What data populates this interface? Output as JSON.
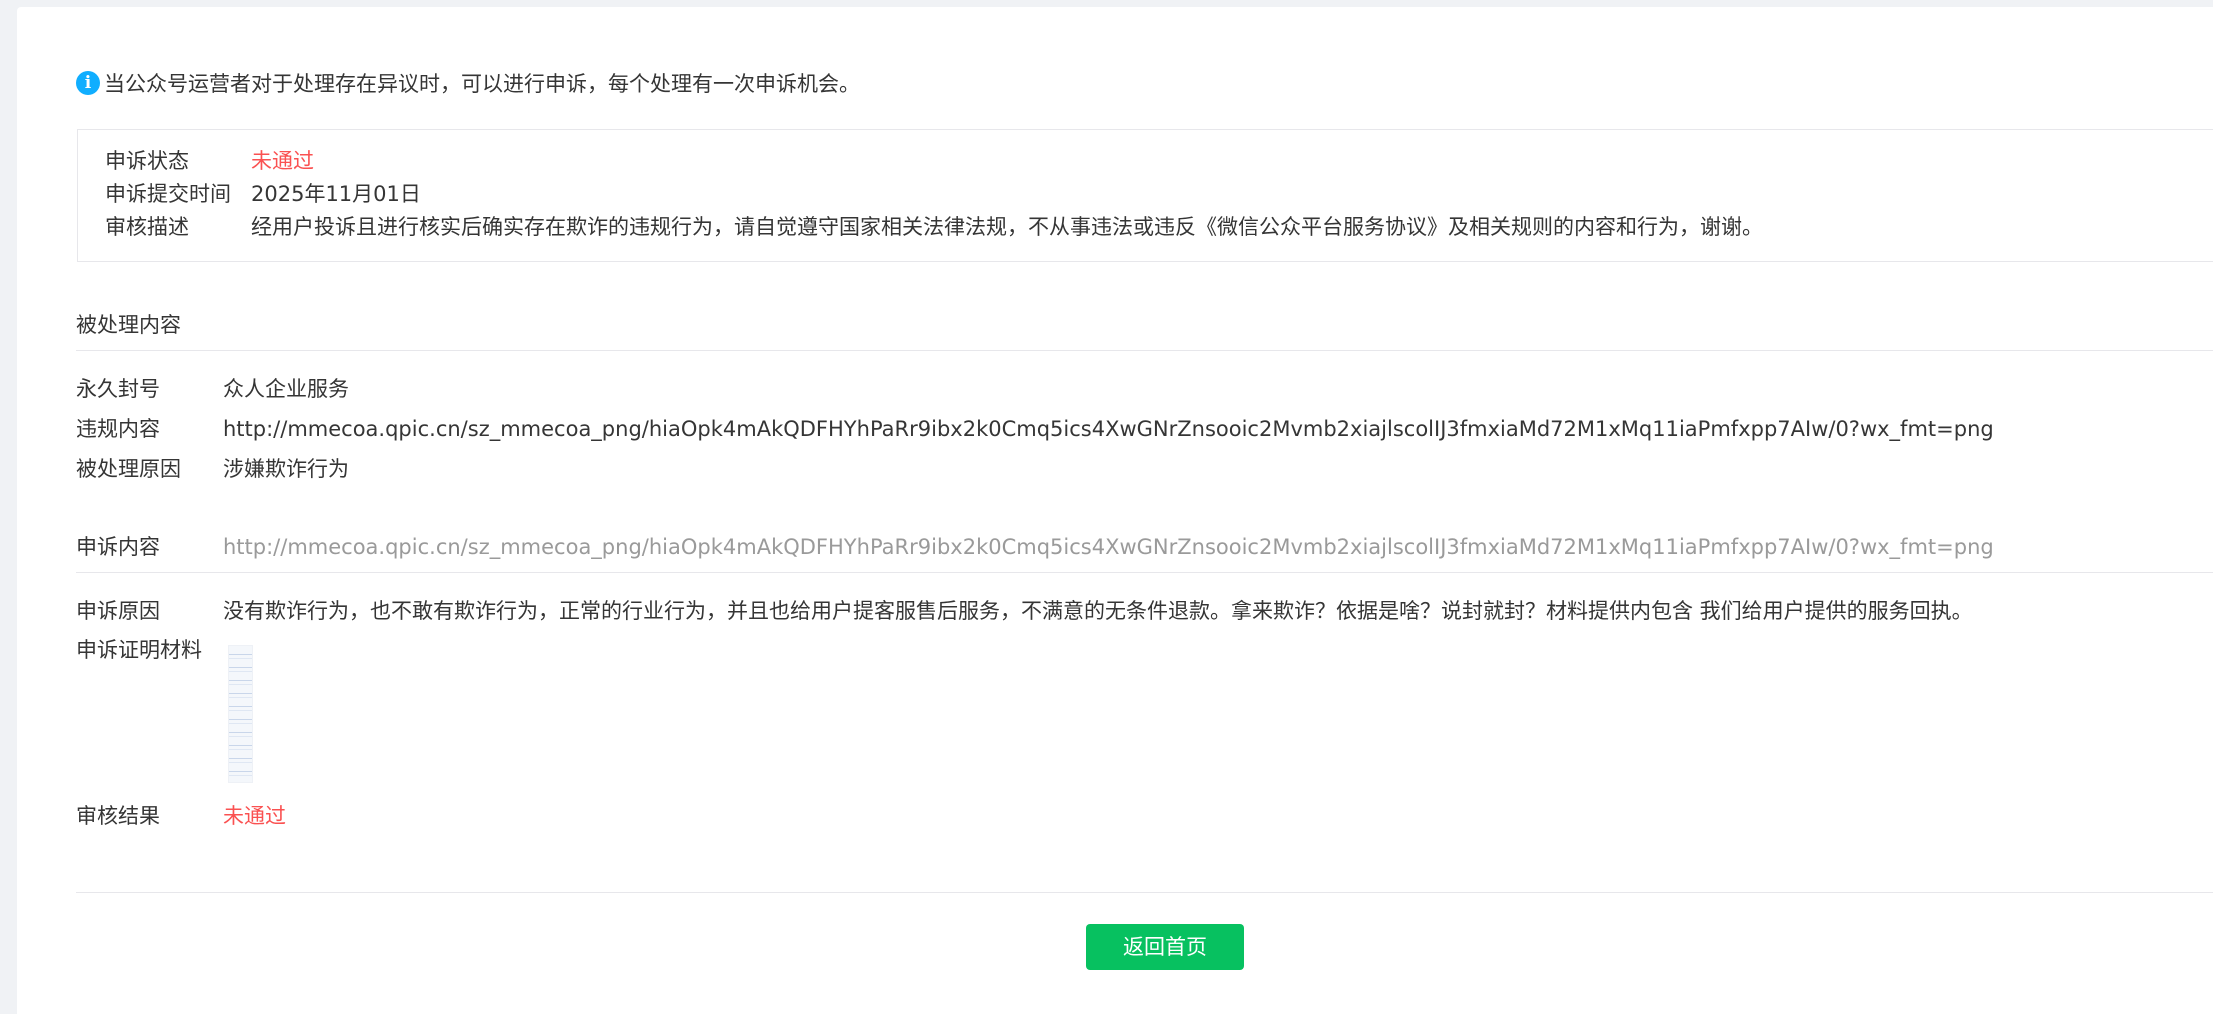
{
  "notice": {
    "icon": "info-icon",
    "icon_color": "#10aeff",
    "text": "当公众号运营者对于处理存在异议时，可以进行申诉，每个处理有一次申诉机会。"
  },
  "appeal_status": {
    "status_label": "申诉状态",
    "status_value": "未通过",
    "submit_time_label": "申诉提交时间",
    "submit_time_value": "2025年11月01日",
    "review_desc_label": "审核描述",
    "review_desc_value": "经用户投诉且进行核实后确实存在欺诈的违规行为，请自觉遵守国家相关法律法规，不从事违法或违反《微信公众平台服务协议》及相关规则的内容和行为，谢谢。"
  },
  "processed": {
    "section_title": "被处理内容",
    "ban_label": "永久封号",
    "ban_value": "众人企业服务",
    "violation_label": "违规内容",
    "violation_value": "http://mmecoa.qpic.cn/sz_mmecoa_png/hiaOpk4mAkQDFHYhPaRr9ibx2k0Cmq5ics4XwGNrZnsooic2Mvmb2xiajlscolIJ3fmxiaMd72M1xMq11iaPmfxpp7AIw/0?wx_fmt=png",
    "reason_label": "被处理原因",
    "reason_value": "涉嫌欺诈行为"
  },
  "appeal": {
    "content_label": "申诉内容",
    "content_value": "http://mmecoa.qpic.cn/sz_mmecoa_png/hiaOpk4mAkQDFHYhPaRr9ibx2k0Cmq5ics4XwGNrZnsooic2Mvmb2xiajlscolIJ3fmxiaMd72M1xMq11iaPmfxpp7AIw/0?wx_fmt=png",
    "reason_label": "申诉原因",
    "reason_value": "没有欺诈行为，也不敢有欺诈行为，正常的行业行为，并且也给用户提客服售后服务，不满意的无条件退款。拿来欺诈？依据是啥？说封就封？材料提供内包含  我们给用户提供的服务回执。",
    "evidence_label": "申诉证明材料",
    "result_label": "审核结果",
    "result_value": "未通过"
  },
  "actions": {
    "back_home_label": "返回首页"
  },
  "colors": {
    "rejected": "#fa5151",
    "primary_button": "#07c160",
    "muted_text": "#9a9a9a"
  }
}
